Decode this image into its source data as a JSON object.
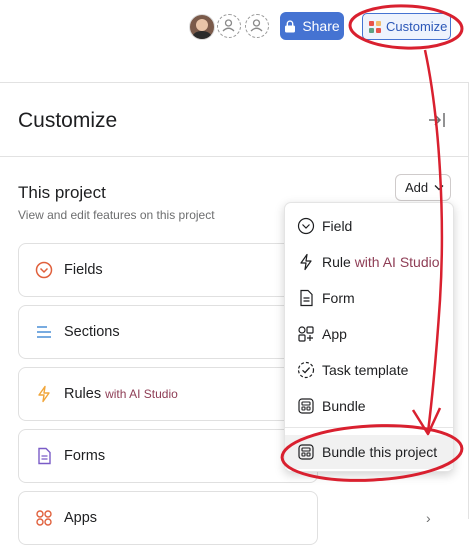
{
  "header": {
    "share_label": "Share",
    "customize_label": "Customize"
  },
  "panel": {
    "title": "Customize",
    "section_title": "This project",
    "section_subtitle": "View and edit features on this project",
    "add_label": "Add"
  },
  "cards": [
    {
      "label": "Fields",
      "suffix": ""
    },
    {
      "label": "Sections",
      "suffix": ""
    },
    {
      "label": "Rules",
      "suffix": "with AI Studio"
    },
    {
      "label": "Forms",
      "suffix": ""
    },
    {
      "label": "Apps",
      "suffix": ""
    }
  ],
  "menu": {
    "items": [
      {
        "label": "Field",
        "suffix": ""
      },
      {
        "label": "Rule",
        "suffix": "with AI Studio"
      },
      {
        "label": "Form",
        "suffix": ""
      },
      {
        "label": "App",
        "suffix": ""
      },
      {
        "label": "Task template",
        "suffix": ""
      },
      {
        "label": "Bundle",
        "suffix": ""
      },
      {
        "label": "Bundle this project",
        "suffix": ""
      }
    ]
  },
  "colors": {
    "accent": "#4573d2",
    "annotation": "#d9202f",
    "ai_text": "#8e3d55"
  }
}
